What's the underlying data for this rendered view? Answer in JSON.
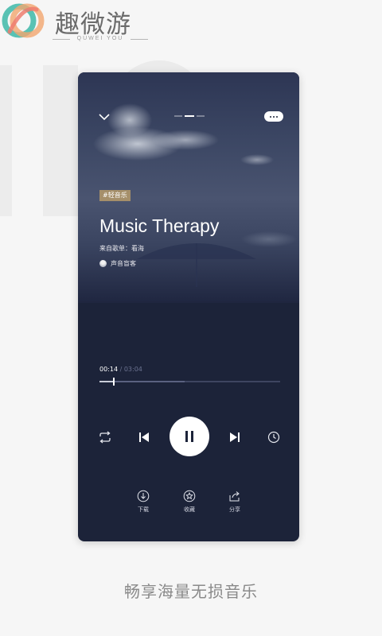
{
  "brand": {
    "name": "趣微游",
    "subtitle": "QUWEI YOU"
  },
  "player": {
    "tag": "#轻音乐",
    "track_title": "Music Therapy",
    "source": "来自歌单：看海",
    "artist": "声音盲客",
    "time_current": "00:14",
    "time_separator": " / ",
    "time_total": "03:04",
    "progress_fraction": 0.076,
    "buffered_fraction": 0.47,
    "state_icon": "pause-icon",
    "actions": [
      {
        "label": "下载",
        "icon": "download-icon"
      },
      {
        "label": "收藏",
        "icon": "star-icon"
      },
      {
        "label": "分享",
        "icon": "share-icon"
      }
    ]
  },
  "caption": "畅享海量无损音乐",
  "colors": {
    "page_bg": "#f6f6f6",
    "player_bg": "#1c2339",
    "tag_bg": "#a58f6a",
    "progress_played": "#c9ccd8",
    "caption": "#8a8a8a"
  }
}
